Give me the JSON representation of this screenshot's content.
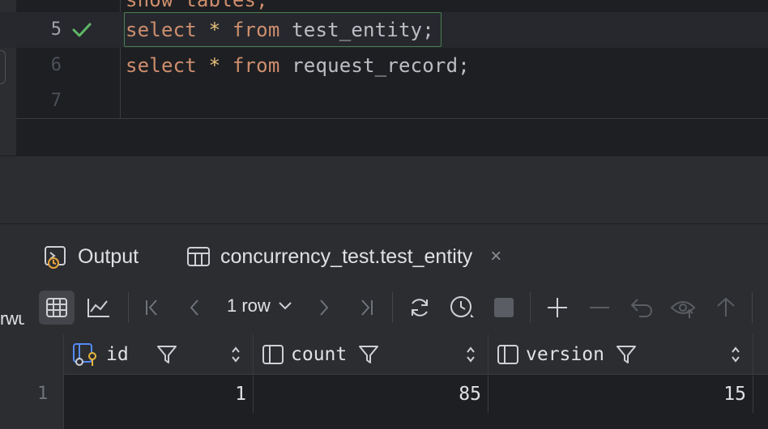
{
  "editor": {
    "partial_top_line": "show tables;",
    "lines": [
      {
        "number": "5",
        "keyword1": "select",
        "star": "*",
        "keyword2": "from",
        "table": "test_entity",
        "semicolon": ";",
        "status": "check-icon"
      },
      {
        "number": "6",
        "keyword1": "select",
        "star": "*",
        "keyword2": "from",
        "table": "request_record",
        "semicolon": ";"
      },
      {
        "number": "7"
      }
    ]
  },
  "left_panel": {
    "clipped_label": "rwu"
  },
  "tool_window": {
    "tabs": [
      {
        "label": "Output",
        "icon": "console-output-icon"
      },
      {
        "label": "concurrency_test.test_entity",
        "icon": "table-icon",
        "close": "×"
      }
    ],
    "toolbar": {
      "rows_label": "1 row"
    },
    "grid": {
      "columns": [
        {
          "name": "id",
          "icon": "primary-key-column-icon"
        },
        {
          "name": "count",
          "icon": "column-icon"
        },
        {
          "name": "version",
          "icon": "column-icon"
        }
      ],
      "rows": [
        {
          "row_number": "1",
          "id": "1",
          "count": "85",
          "version": "15"
        }
      ]
    }
  },
  "colors": {
    "keyword": "#cf8e6d",
    "operator": "#e6c07b",
    "identifier": "#bcbec4",
    "success_check": "#5fb865",
    "statement_border": "#4a7f4e"
  }
}
